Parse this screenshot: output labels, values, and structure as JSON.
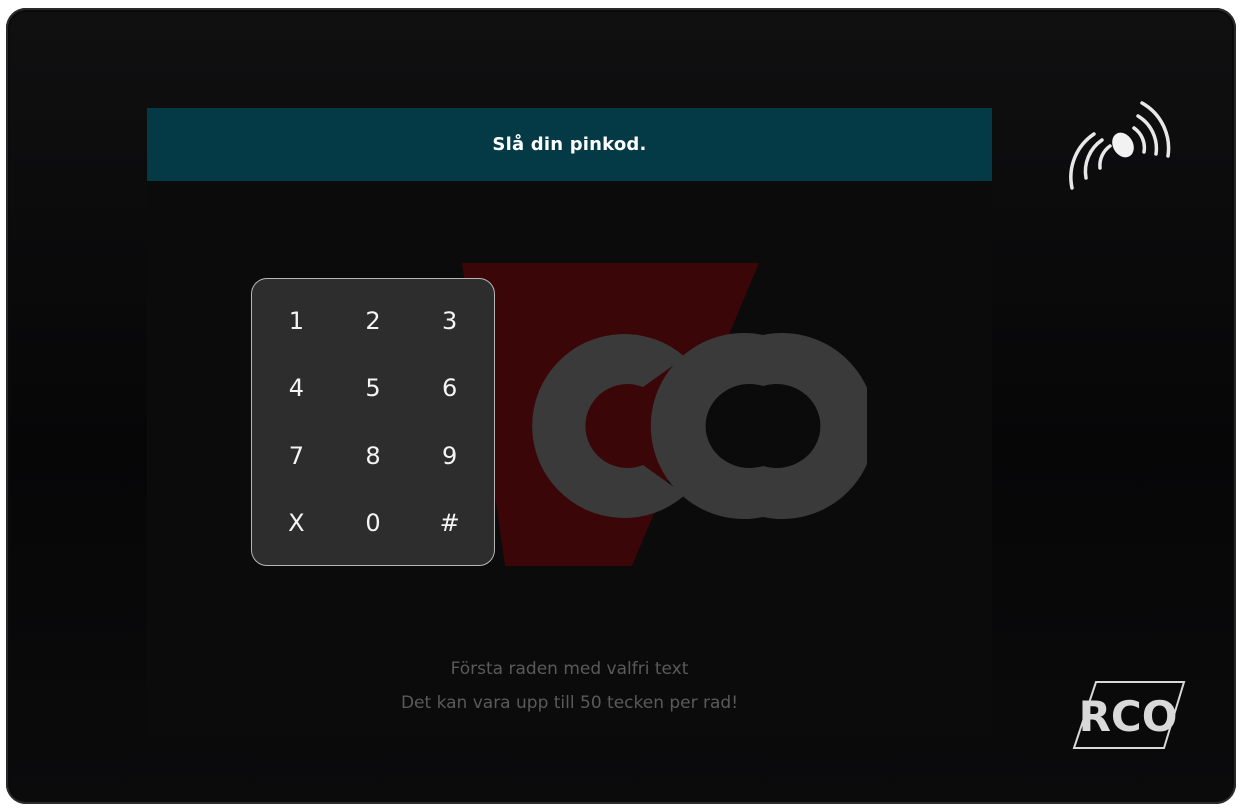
{
  "header": {
    "prompt": "Slå din pinkod."
  },
  "keypad": {
    "keys": [
      "1",
      "2",
      "3",
      "4",
      "5",
      "6",
      "7",
      "8",
      "9",
      "X",
      "0",
      "#"
    ]
  },
  "footer": {
    "line1": "Första raden med valfri text",
    "line2": "Det kan vara upp till 50 tecken per rad!"
  },
  "logo": {
    "text": "RCO"
  },
  "icons": {
    "nfc": "nfc-contactless-icon",
    "logo": "rco-logo"
  },
  "colors": {
    "header_bar": "#043a45",
    "logo_red": "#3a0608",
    "logo_gray": "#3a3a3a",
    "keypad_bg": "#2d2d2d",
    "footer_text": "#5a5a5a"
  }
}
